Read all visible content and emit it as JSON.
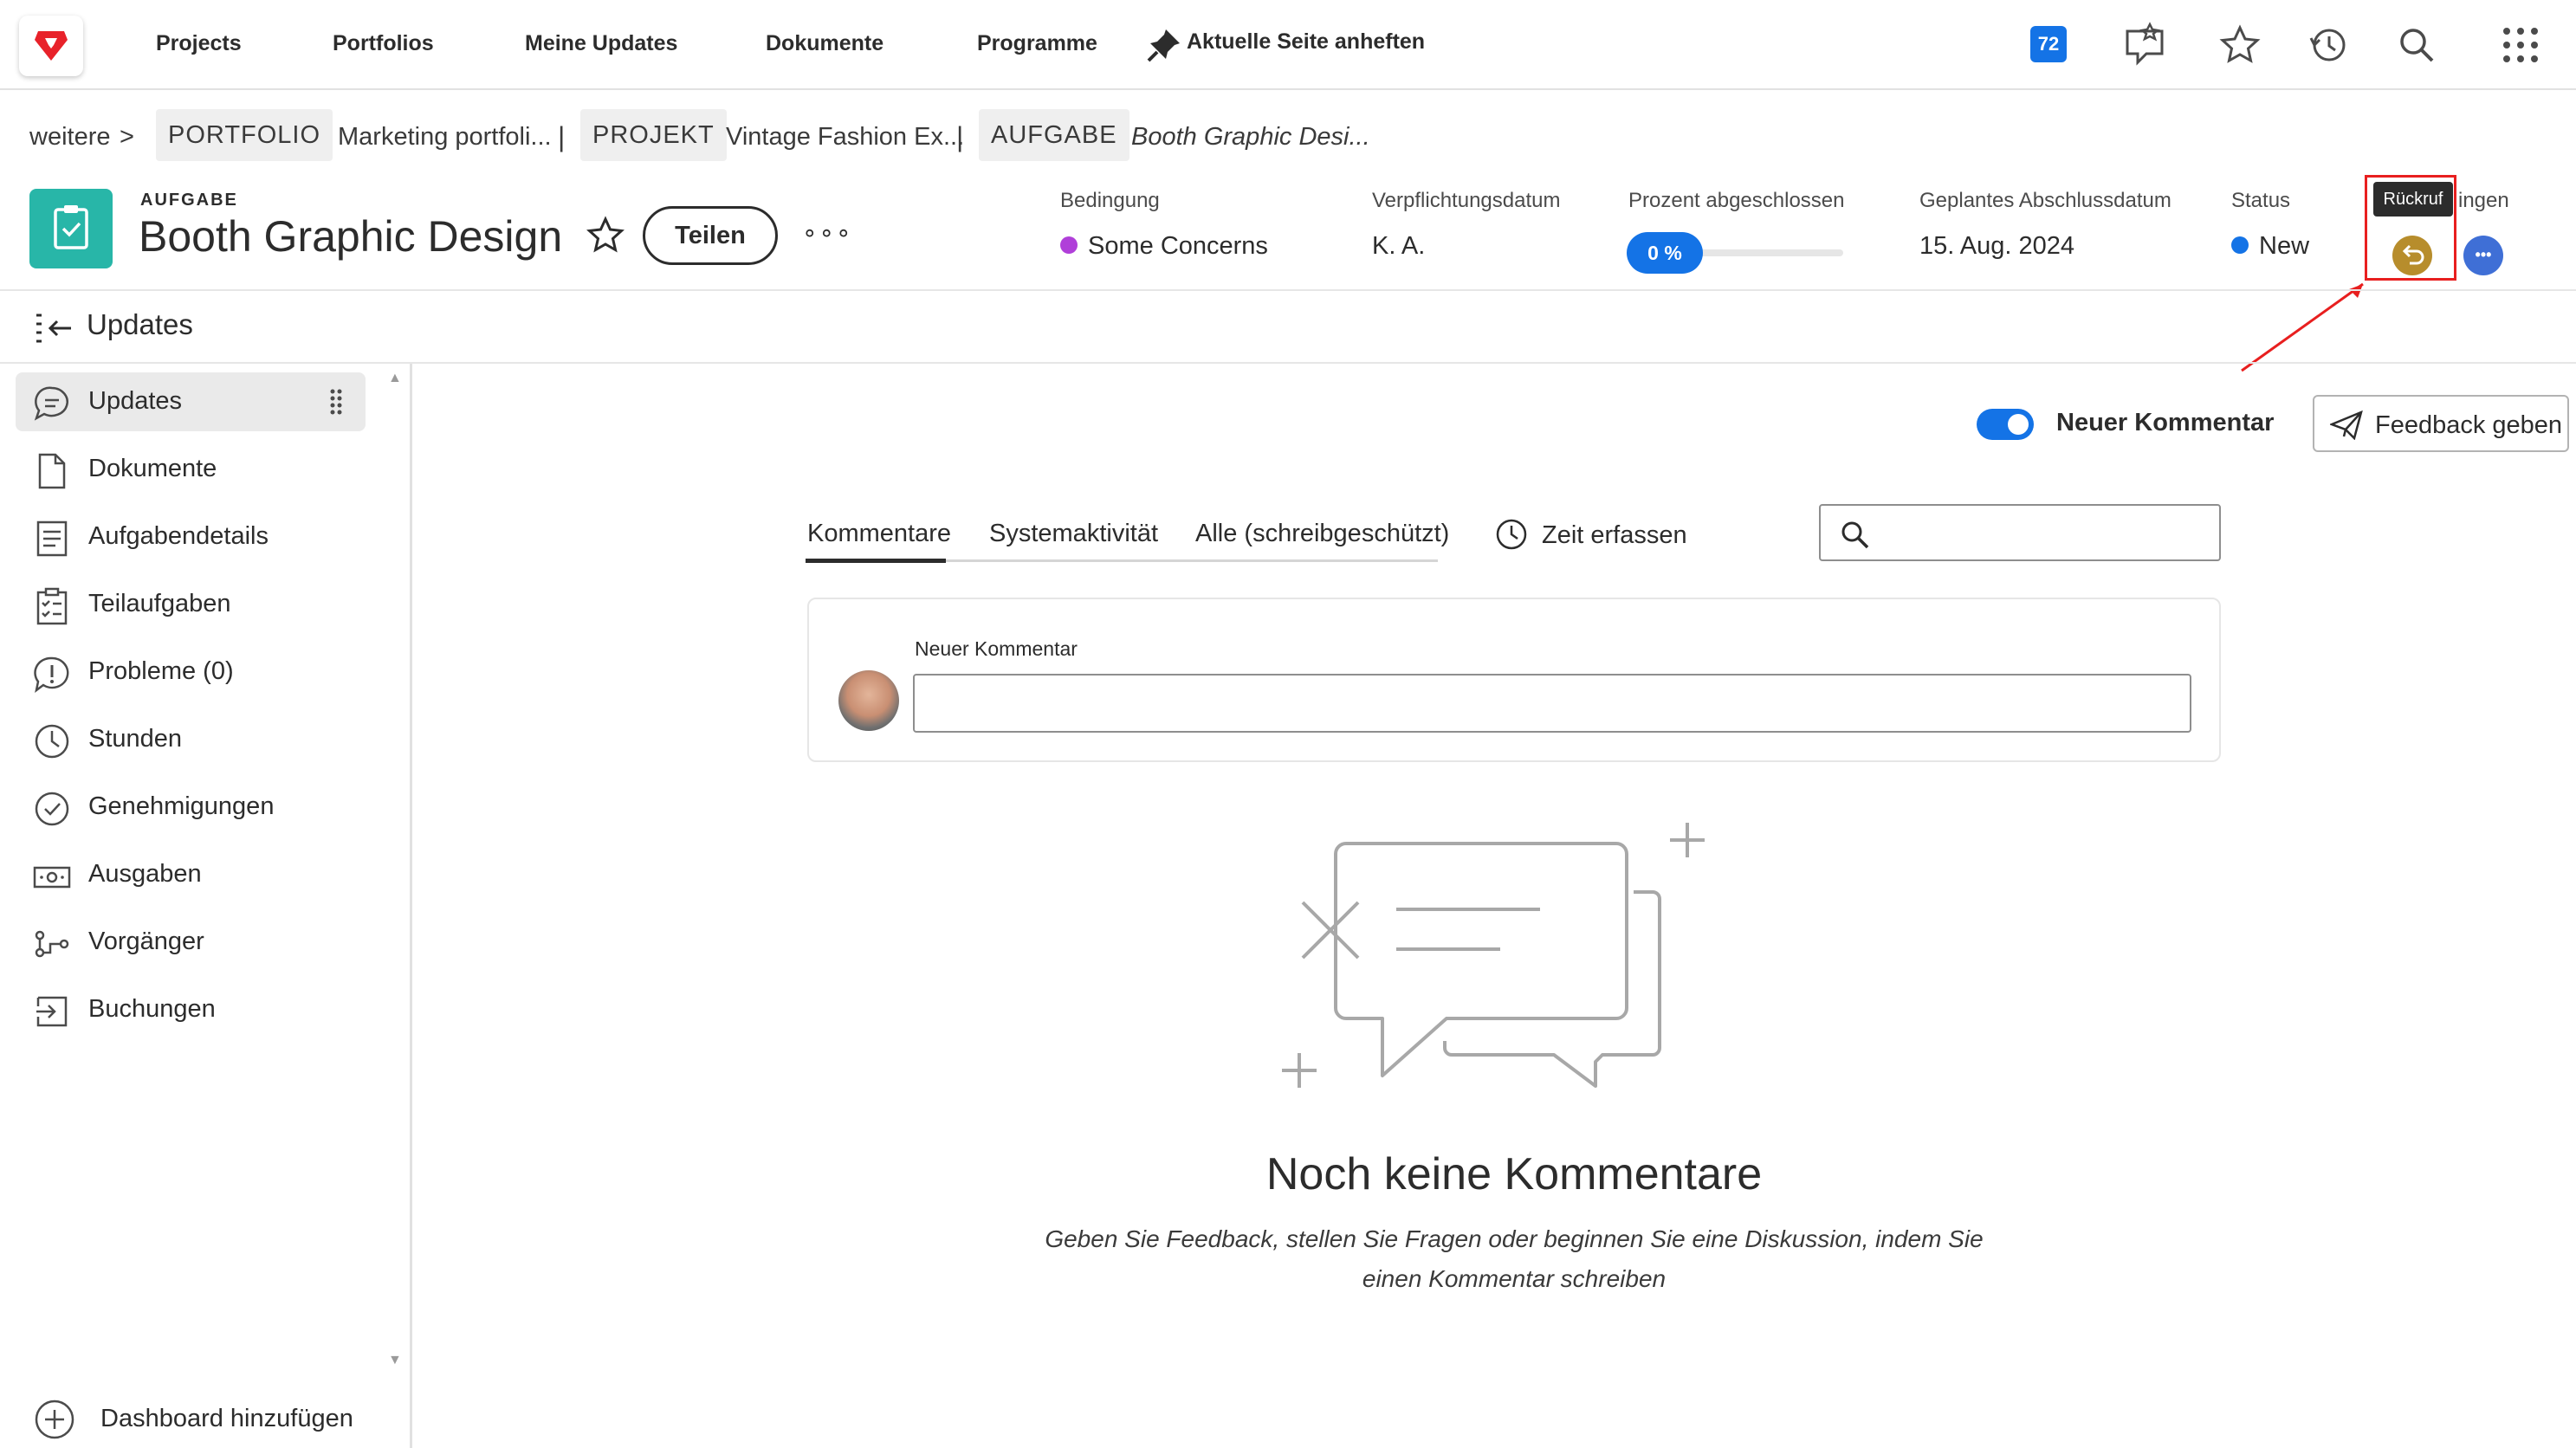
{
  "topnav": {
    "links": [
      "Projects",
      "Portfolios",
      "Meine Updates",
      "Dokumente",
      "Programme"
    ],
    "pin_label": "Aktuelle Seite anheften",
    "notification_count": "72"
  },
  "breadcrumb": {
    "more": "weitere",
    "more_chevron": ">",
    "separator": "|",
    "portfolio_tag": "PORTFOLIO",
    "portfolio_name": "Marketing portfoli...",
    "project_tag": "PROJEKT",
    "project_name": "Vintage Fashion Ex...",
    "task_tag": "AUFGABE",
    "task_name": "Booth Graphic Desi..."
  },
  "header": {
    "object_type": "AUFGABE",
    "title": "Booth Graphic Design",
    "share_label": "Teilen",
    "more_label": "∘∘∘",
    "fields": {
      "condition_label": "Bedingung",
      "condition_value": "Some Concerns",
      "condition_color": "#b03fd9",
      "commit_label": "Verpflichtungsdatum",
      "commit_value": "K. A.",
      "percent_label": "Prozent abgeschlossen",
      "percent_value": "0 %",
      "percent_complete": 0,
      "planned_label": "Geplantes Abschlussdatum",
      "planned_value": "15. Aug. 2024",
      "status_label": "Status",
      "status_value": "New",
      "status_color": "#1473e6",
      "approvals_label_partial": "ingen"
    },
    "tooltip": "Rückruf",
    "more_button": "•••"
  },
  "section": {
    "title": "Updates"
  },
  "sidebar": {
    "items": [
      {
        "label": "Updates",
        "icon": "speech-bubble-icon"
      },
      {
        "label": "Dokumente",
        "icon": "document-icon"
      },
      {
        "label": "Aufgabendetails",
        "icon": "details-icon"
      },
      {
        "label": "Teilaufgaben",
        "icon": "checklist-icon"
      },
      {
        "label": "Probleme (0)",
        "icon": "issue-icon"
      },
      {
        "label": "Stunden",
        "icon": "clock-icon"
      },
      {
        "label": "Genehmigungen",
        "icon": "approval-icon"
      },
      {
        "label": "Ausgaben",
        "icon": "money-icon"
      },
      {
        "label": "Vorgänger",
        "icon": "predecessor-icon"
      },
      {
        "label": "Buchungen",
        "icon": "booking-icon"
      }
    ],
    "add_dashboard": "Dashboard hinzufügen"
  },
  "main": {
    "toggle_label": "Neuer Kommentar",
    "feedback_label": "Feedback geben",
    "tabs": [
      "Kommentare",
      "Systemaktivität",
      "Alle (schreibgeschützt)"
    ],
    "log_time": "Zeit erfassen",
    "comment_label": "Neuer Kommentar",
    "empty_title": "Noch keine Kommentare",
    "empty_subtitle": "Geben Sie Feedback, stellen Sie Fragen oder beginnen Sie eine Diskussion, indem Sie einen Kommentar schreiben"
  }
}
